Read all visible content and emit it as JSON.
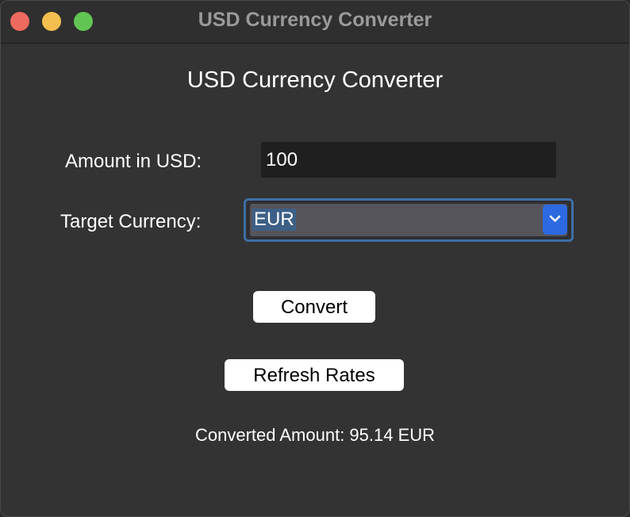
{
  "window": {
    "title": "USD Currency Converter",
    "traffic_lights": {
      "close_color": "#ed6a5e",
      "minimize_color": "#f5bf4f",
      "maximize_color": "#61c554"
    }
  },
  "main": {
    "heading": "USD Currency Converter",
    "amount_label": "Amount in USD:",
    "amount_value": "100",
    "target_label": "Target Currency:",
    "target_value": "EUR",
    "convert_label": "Convert",
    "refresh_label": "Refresh Rates",
    "result_text": "Converted Amount: 95.14 EUR"
  },
  "colors": {
    "background": "#333333",
    "accent": "#2d69e0",
    "focus_ring": "#3e6fa7"
  }
}
